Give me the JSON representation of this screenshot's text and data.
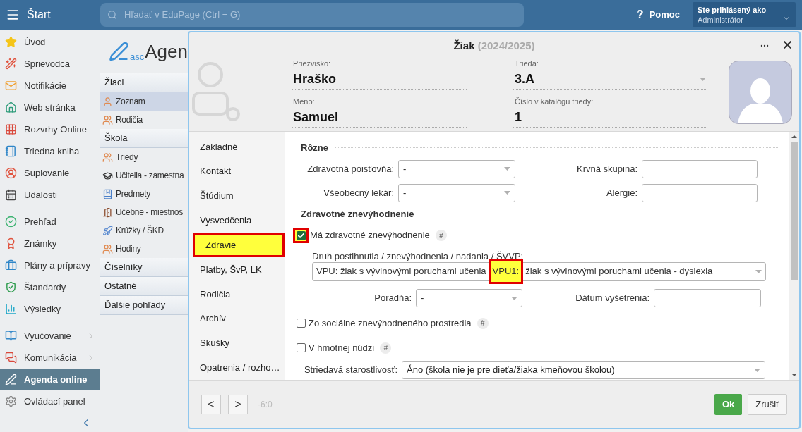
{
  "topbar": {
    "title": "Štart",
    "search": {
      "placeholder": "Hľadať v EduPage (Ctrl + G)"
    },
    "help_mark": "?",
    "help": "Pomoc",
    "user": {
      "caption": "Ste prihlásený ako",
      "name": "Administrátor"
    }
  },
  "sidebar": {
    "groups": [
      [
        {
          "label": "Úvod",
          "selected": false,
          "submenu": false
        },
        {
          "label": "Sprievodca",
          "selected": false,
          "submenu": false
        },
        {
          "label": "Notifikácie",
          "selected": false,
          "submenu": false
        },
        {
          "label": "Web stránka",
          "selected": false,
          "submenu": false
        },
        {
          "label": "Rozvrhy Online",
          "selected": false,
          "submenu": false
        },
        {
          "label": "Triedna kniha",
          "selected": false,
          "submenu": false
        },
        {
          "label": "Suplovanie",
          "selected": false,
          "submenu": false
        },
        {
          "label": "Udalosti",
          "selected": false,
          "submenu": false
        }
      ],
      [
        {
          "label": "Prehľad",
          "selected": false,
          "submenu": false
        },
        {
          "label": "Známky",
          "selected": false,
          "submenu": false
        },
        {
          "label": "Plány a prípravy",
          "selected": false,
          "submenu": false
        },
        {
          "label": "Štandardy",
          "selected": false,
          "submenu": false
        },
        {
          "label": "Výsledky",
          "selected": false,
          "submenu": false
        }
      ],
      [
        {
          "label": "Vyučovanie",
          "selected": false,
          "submenu": true
        },
        {
          "label": "Komunikácia",
          "selected": false,
          "submenu": true
        },
        {
          "label": "Agenda online",
          "selected": true,
          "submenu": false
        },
        {
          "label": "Ovládací panel",
          "selected": false,
          "submenu": false
        }
      ]
    ]
  },
  "agenda_nav": {
    "logo": {
      "prefix": "asc",
      "name": "Agen"
    },
    "sections": [
      {
        "title": "Žiaci",
        "items": [
          {
            "label": "Zoznam",
            "selected": true
          },
          {
            "label": "Rodičia",
            "selected": false
          }
        ]
      },
      {
        "title": "Škola",
        "items": [
          {
            "label": "Triedy",
            "selected": false
          },
          {
            "label": "Učitelia - zamestna",
            "selected": false
          },
          {
            "label": "Predmety",
            "selected": false
          },
          {
            "label": "Učebne - miestnos",
            "selected": false
          },
          {
            "label": "Krúžky / ŠKD",
            "selected": false
          },
          {
            "label": "Hodiny",
            "selected": false
          }
        ]
      },
      {
        "title": "Číselníky"
      },
      {
        "title": "Ostatné"
      },
      {
        "title": "Ďalšie pohľady"
      }
    ]
  },
  "dialog": {
    "title": "Žiak",
    "subtitle": "(2024/2025)",
    "fields": [
      {
        "label": "Priezvisko:",
        "value": "Hraško",
        "kind": "text"
      },
      {
        "label": "Trieda:",
        "value": "3.A",
        "kind": "select"
      },
      {
        "label": "Meno:",
        "value": "Samuel",
        "kind": "text"
      },
      {
        "label": "Číslo v katalógu triedy:",
        "value": "1",
        "kind": "text"
      }
    ],
    "tabs": [
      {
        "label": "Základné",
        "selected": false
      },
      {
        "label": "Kontakt",
        "selected": false
      },
      {
        "label": "Štúdium",
        "selected": false
      },
      {
        "label": "Vysvedčenia",
        "selected": false
      },
      {
        "label": "Zdravie",
        "selected": true
      },
      {
        "label": "Platby, ŠvP, LK",
        "selected": false
      },
      {
        "label": "Rodičia",
        "selected": false
      },
      {
        "label": "Archív",
        "selected": false
      },
      {
        "label": "Skúšky",
        "selected": false
      },
      {
        "label": "Opatrenia / rozho…",
        "selected": false
      }
    ],
    "content": [
      {
        "kind": "section",
        "title": "Rôzne"
      },
      {
        "kind": "pair",
        "left": {
          "label": "Zdravotná poisťovňa:",
          "value": "-"
        },
        "right": {
          "label": "Krvná skupina:"
        }
      },
      {
        "kind": "pair",
        "left": {
          "label": "Všeobecný lekár:",
          "value": "-"
        },
        "right": {
          "label": "Alergie:"
        }
      },
      {
        "kind": "section",
        "title": "Zdravotné znevýhodnenie"
      },
      {
        "kind": "checkbox",
        "label": "Má zdravotné znevýhodnenie",
        "checked": true,
        "highlighted": true,
        "tag": "#"
      },
      {
        "kind": "wide_select",
        "label": "Druh postihnutia / znevýhodnenia / nadania / ŠVVP:",
        "parts": [
          {
            "text": "VPU: žiak s vývinovými poruchami učenia",
            "highlighted": false
          },
          {
            "text": "VPU1:",
            "highlighted": true
          },
          {
            "text": "žiak s vývinovými poruchami učenia - dyslexia",
            "highlighted": false
          }
        ]
      },
      {
        "kind": "pair_narrow",
        "left": {
          "label": "Poradňa:",
          "value": "-"
        },
        "right": {
          "label": "Dátum vyšetrenia:"
        }
      },
      {
        "kind": "checkbox",
        "label": "Zo sociálne znevýhodneného prostredia",
        "checked": false,
        "highlighted": false,
        "tag": "#"
      },
      {
        "kind": "checkbox",
        "label": "V hmotnej núdzi",
        "checked": false,
        "highlighted": false,
        "tag": "#"
      },
      {
        "kind": "select_row",
        "label": "Striedavá starostlivosť:",
        "value": "Áno (škola nie je pre dieťa/žiaka kmeňovou školou)"
      }
    ],
    "footer": {
      "prev": "<",
      "next": ">",
      "counter": "-6:0",
      "ok": "Ok",
      "cancel": "Zrušiť"
    }
  }
}
